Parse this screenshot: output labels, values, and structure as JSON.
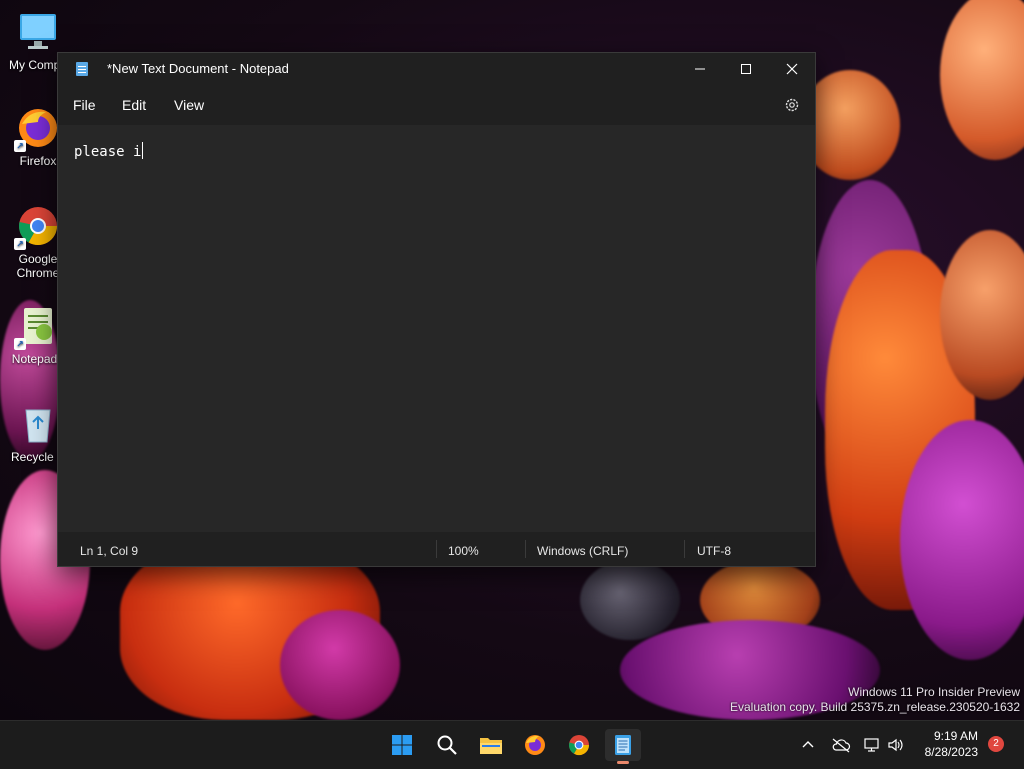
{
  "window": {
    "title": "*New Text Document - Notepad",
    "menu": [
      "File",
      "Edit",
      "View"
    ],
    "editor_text": "please i"
  },
  "status": {
    "position": "Ln 1, Col 9",
    "zoom": "100%",
    "line_ending": "Windows (CRLF)",
    "encoding": "UTF-8"
  },
  "desktop_icons": [
    {
      "label": "My Compu",
      "icon": "computer-icon"
    },
    {
      "label": "Firefox",
      "icon": "firefox-icon"
    },
    {
      "label": "Google Chrome",
      "icon": "chrome-icon"
    },
    {
      "label": "Notepad+",
      "icon": "notepadpp-icon"
    },
    {
      "label": "Recycle B",
      "icon": "recycle-bin-icon"
    }
  ],
  "watermark": {
    "line1": "Windows 11 Pro Insider Preview",
    "line2": "Evaluation copy. Build 25375.zn_release.230520-1632"
  },
  "taskbar": {
    "time": "9:19 AM",
    "date": "8/28/2023",
    "notification_count": "2",
    "apps": [
      "start-icon",
      "search-icon",
      "file-explorer-icon",
      "firefox-icon",
      "chrome-icon",
      "notepad-icon"
    ]
  },
  "colors": {
    "accent": "#e9886b",
    "window_bg": "#202020",
    "editor_bg": "#272727"
  }
}
